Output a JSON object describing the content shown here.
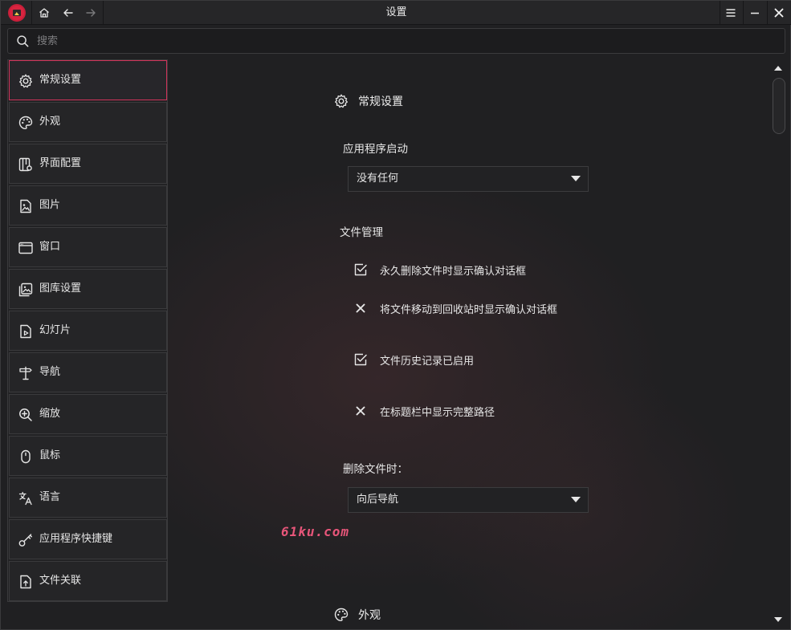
{
  "window": {
    "title": "设置"
  },
  "search": {
    "placeholder": "搜索",
    "value": ""
  },
  "sidebar": {
    "items": [
      {
        "label": "常规设置",
        "icon": "gear-icon",
        "active": true
      },
      {
        "label": "外观",
        "icon": "palette-icon",
        "active": false
      },
      {
        "label": "界面配置",
        "icon": "layout-config-icon",
        "active": false
      },
      {
        "label": "图片",
        "icon": "image-file-icon",
        "active": false
      },
      {
        "label": "窗口",
        "icon": "window-icon",
        "active": false
      },
      {
        "label": "图库设置",
        "icon": "gallery-icon",
        "active": false
      },
      {
        "label": "幻灯片",
        "icon": "slideshow-icon",
        "active": false
      },
      {
        "label": "导航",
        "icon": "signpost-icon",
        "active": false
      },
      {
        "label": "缩放",
        "icon": "zoom-icon",
        "active": false
      },
      {
        "label": "鼠标",
        "icon": "mouse-icon",
        "active": false
      },
      {
        "label": "语言",
        "icon": "translate-icon",
        "active": false
      },
      {
        "label": "应用程序快捷键",
        "icon": "key-icon",
        "active": false
      },
      {
        "label": "文件关联",
        "icon": "file-association-icon",
        "active": false
      }
    ]
  },
  "general": {
    "heading": "常规设置",
    "startup_label": "应用程序启动",
    "startup_value": "没有任何",
    "file_mgmt_label": "文件管理",
    "options": [
      {
        "label": "永久删除文件时显示确认对话框",
        "checked": true
      },
      {
        "label": "将文件移动到回收站时显示确认对话框",
        "checked": false
      },
      {
        "label": "文件历史记录已启用",
        "checked": true
      },
      {
        "label": "在标题栏中显示完整路径",
        "checked": false
      }
    ],
    "delete_label": "删除文件时：",
    "delete_value": "向后导航"
  },
  "appearance": {
    "heading": "外观"
  },
  "watermark": "61ku.com",
  "colors": {
    "accent": "#d0335a",
    "background": "#202022",
    "watermark": "#e8567a"
  }
}
